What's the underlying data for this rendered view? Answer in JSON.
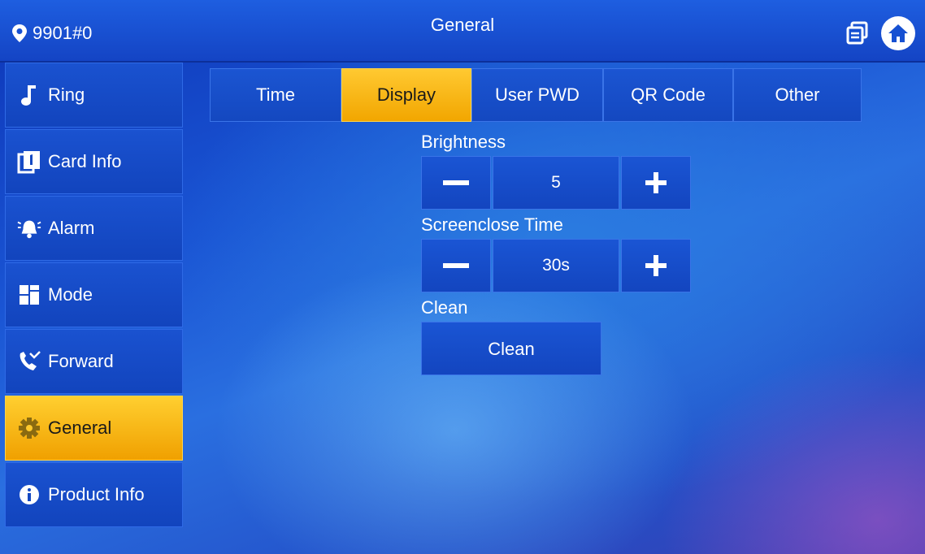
{
  "header": {
    "location": "9901#0",
    "title": "General"
  },
  "sidebar": {
    "items": [
      {
        "label": "Ring",
        "icon": "music-note-icon"
      },
      {
        "label": "Card Info",
        "icon": "card-icon"
      },
      {
        "label": "Alarm",
        "icon": "alarm-icon"
      },
      {
        "label": "Mode",
        "icon": "mode-grid-icon"
      },
      {
        "label": "Forward",
        "icon": "forward-call-icon"
      },
      {
        "label": "General",
        "icon": "gear-icon",
        "active": true
      },
      {
        "label": "Product Info",
        "icon": "info-icon"
      }
    ]
  },
  "tabs": [
    {
      "label": "Time"
    },
    {
      "label": "Display",
      "active": true
    },
    {
      "label": "User PWD"
    },
    {
      "label": "QR Code"
    },
    {
      "label": "Other"
    }
  ],
  "display": {
    "brightness_label": "Brightness",
    "brightness_value": "5",
    "screenclose_label": "Screenclose Time",
    "screenclose_value": "30s",
    "clean_label": "Clean",
    "clean_button": "Clean"
  },
  "colors": {
    "accent": "#f5b400",
    "panel": "#1449c2",
    "header": "#1650d2"
  }
}
